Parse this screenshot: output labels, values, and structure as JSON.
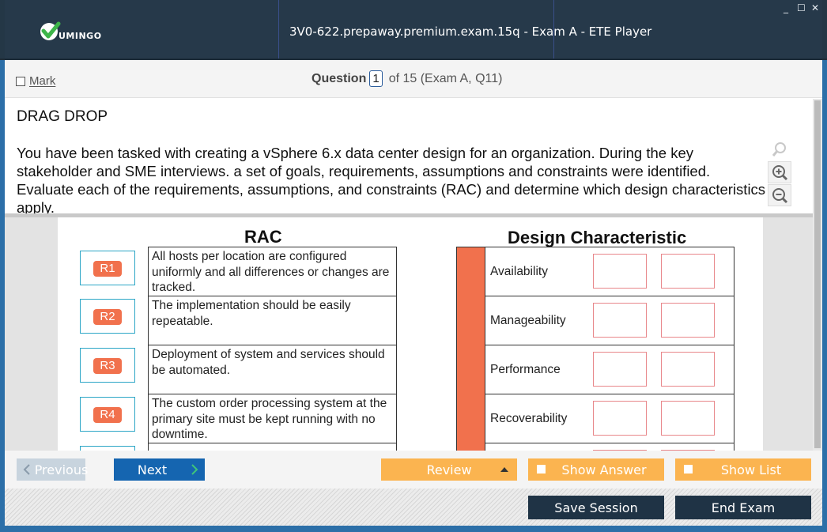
{
  "window": {
    "title": "3V0-622.prepaway.premium.exam.15q - Exam A - ETE Player",
    "logo_text": "UMINGO",
    "controls": {
      "minimize": "_",
      "maximize": "☐",
      "close": "✕"
    }
  },
  "header": {
    "mark_label": "Mark",
    "question_label": "Question",
    "question_number": "1",
    "question_of": "of 15 (Exam A, Q11)"
  },
  "question": {
    "type": "DRAG DROP",
    "text": "You have been tasked with creating a vSphere 6.x data center design for an organization. During the key stakeholder and SME interviews. a set of goals, requirements, assumptions and constraints were identified. Evaluate each of the requirements, assumptions, and constraints (RAC) and determine which design characteristics apply."
  },
  "exhibit": {
    "rac_title": "RAC",
    "dc_title": "Design Characteristic",
    "rac_items": [
      {
        "id": "R1",
        "text": "All hosts per location are configured uniformly and all differences or changes are tracked."
      },
      {
        "id": "R2",
        "text": "The implementation should be easily repeatable."
      },
      {
        "id": "R3",
        "text": "Deployment of system and services should be automated."
      },
      {
        "id": "R4",
        "text": "The custom order processing system at the primary site must be kept running with no downtime."
      },
      {
        "id": "",
        "text": ""
      }
    ],
    "characteristics": [
      "Availability",
      "Manageability",
      "Performance",
      "Recoverability",
      ""
    ],
    "colors": {
      "accent": "#f1714d",
      "chip_border": "#2ca6c6",
      "slot_border": "#e8868a"
    }
  },
  "nav": {
    "previous": "Previous",
    "next": "Next",
    "review": "Review",
    "show_answer": "Show Answer",
    "show_list": "Show List"
  },
  "session": {
    "save": "Save Session",
    "end": "End Exam"
  }
}
